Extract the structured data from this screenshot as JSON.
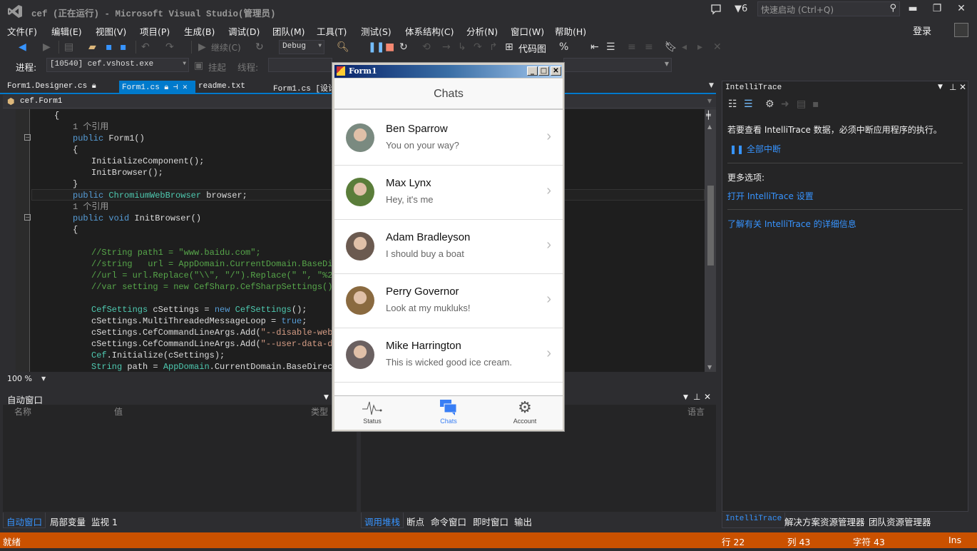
{
  "window": {
    "title": "cef (正在运行) - Microsoft Visual Studio(管理员)",
    "notifications_count": "6",
    "quick_launch_placeholder": "快速启动 (Ctrl+Q)",
    "login_label": "登录"
  },
  "menu": [
    "文件(F)",
    "编辑(E)",
    "视图(V)",
    "项目(P)",
    "生成(B)",
    "调试(D)",
    "团队(M)",
    "工具(T)",
    "测试(S)",
    "体系结构(C)",
    "分析(N)",
    "窗口(W)",
    "帮助(H)"
  ],
  "toolbar": {
    "continue_label": "继续(C)",
    "config_value": "Debug",
    "codemap_label": "代码图",
    "process_label": "进程:",
    "process_value": "[10540] cef.vshost.exe",
    "suspend_label": "挂起",
    "thread_label": "线程:"
  },
  "doc_tabs": [
    {
      "label": "Form1.Designer.cs",
      "active": false
    },
    {
      "label": "Form1.cs",
      "active": true
    },
    {
      "label": "readme.txt",
      "active": false
    },
    {
      "label": "Form1.cs [设计",
      "active": false
    }
  ],
  "nav_bar": {
    "class_value": "cef.Form1"
  },
  "editor": {
    "zoom": "100 %",
    "ref_count_text": "1 个引用",
    "lines": [
      {
        "indent": 1,
        "text": "{"
      },
      {
        "indent": 2,
        "text": "1 个引用",
        "cls": "ref"
      },
      {
        "indent": 2,
        "html": "<span class='kw'>public</span> Form1()"
      },
      {
        "indent": 2,
        "text": "{"
      },
      {
        "indent": 3,
        "text": "InitializeComponent();"
      },
      {
        "indent": 3,
        "text": "InitBrowser();"
      },
      {
        "indent": 2,
        "text": "}"
      },
      {
        "indent": 2,
        "html": "<span class='kw'>public</span> <span class='ty'>ChromiumWebBrowser</span> browser;"
      },
      {
        "indent": 2,
        "text": "1 个引用",
        "cls": "ref"
      },
      {
        "indent": 2,
        "html": "<span class='kw'>public void</span> InitBrowser()"
      },
      {
        "indent": 2,
        "text": "{"
      },
      {
        "indent": 0,
        "text": ""
      },
      {
        "indent": 3,
        "text": "//String path1 = \"www.baidu.com\";",
        "cls": "cm"
      },
      {
        "indent": 3,
        "text": "//string   url = AppDomain.CurrentDomain.BaseDir",
        "cls": "cm"
      },
      {
        "indent": 3,
        "text": "//url = url.Replace(\"\\\\\", \"/\").Replace(\" \", \"%20",
        "cls": "cm"
      },
      {
        "indent": 3,
        "text": "//var setting = new CefSharp.CefSharpSettings();",
        "cls": "cm"
      },
      {
        "indent": 0,
        "text": ""
      },
      {
        "indent": 3,
        "html": "<span class='ty'>CefSettings</span> cSettings = <span class='kw'>new</span> <span class='ty'>CefSettings</span>();"
      },
      {
        "indent": 3,
        "html": "cSettings.MultiThreadedMessageLoop = <span class='kw'>true</span>;"
      },
      {
        "indent": 3,
        "html": "cSettings.CefCommandLineArgs.Add(<span class='st'>\"--disable-web-</span>"
      },
      {
        "indent": 3,
        "html": "cSettings.CefCommandLineArgs.Add(<span class='st'>\"--user-data-di</span>"
      },
      {
        "indent": 3,
        "html": "<span class='ty'>Cef</span>.Initialize(cSettings);"
      },
      {
        "indent": 3,
        "html": "<span class='ty'>String</span> path = <span class='ty'>AppDomain</span>.CurrentDomain.BaseDirect"
      }
    ]
  },
  "intellitrace": {
    "title": "IntelliTrace",
    "message": "若要查看 IntelliTrace 数据，必须中断应用程序的执行。",
    "break_all": "全部中断",
    "more_options": "更多选项:",
    "open_settings": "打开 IntelliTrace 设置",
    "learn_more": "了解有关 IntelliTrace 的详细信息"
  },
  "auto_window": {
    "title": "自动窗口",
    "columns": [
      "名称",
      "值",
      "类型"
    ],
    "tabs": [
      {
        "label": "自动窗口",
        "active": true
      },
      {
        "label": "局部变量",
        "active": false
      },
      {
        "label": "监视 1",
        "active": false
      }
    ]
  },
  "call_stack": {
    "columns": [
      "语言"
    ],
    "tabs": [
      {
        "label": "调用堆栈",
        "active": true
      },
      {
        "label": "断点",
        "active": false
      },
      {
        "label": "命令窗口",
        "active": false
      },
      {
        "label": "即时窗口",
        "active": false
      },
      {
        "label": "输出",
        "active": false
      }
    ]
  },
  "right_tabs": [
    {
      "label": "IntelliTrace",
      "active": true
    },
    {
      "label": "解决方案资源管理器",
      "active": false
    },
    {
      "label": "团队资源管理器",
      "active": false
    }
  ],
  "status": {
    "state": "就绪",
    "line": "行 22",
    "col": "列 43",
    "char": "字符 43",
    "mode": "Ins"
  },
  "form1": {
    "title": "Form1",
    "header": "Chats",
    "chats": [
      {
        "name": "Ben Sparrow",
        "message": "You on your way?",
        "color": "#7a8a80"
      },
      {
        "name": "Max Lynx",
        "message": "Hey, it's me",
        "color": "#5a7d3a"
      },
      {
        "name": "Adam Bradleyson",
        "message": "I should buy a boat",
        "color": "#6b5a50"
      },
      {
        "name": "Perry Governor",
        "message": "Look at my mukluks!",
        "color": "#8a6a40"
      },
      {
        "name": "Mike Harrington",
        "message": "This is wicked good ice cream.",
        "color": "#6a6060"
      }
    ],
    "tabs": [
      {
        "label": "Status",
        "active": false
      },
      {
        "label": "Chats",
        "active": true
      },
      {
        "label": "Account",
        "active": false
      }
    ],
    "accent": "#387ef5"
  }
}
